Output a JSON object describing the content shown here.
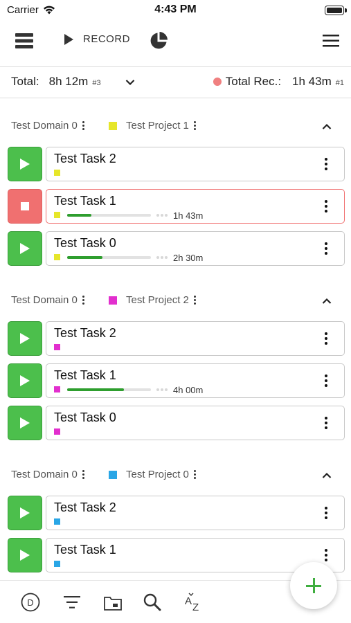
{
  "status_bar": {
    "carrier": "Carrier",
    "time": "4:43 PM"
  },
  "toolbar": {
    "record_label": "RECORD",
    "icons": [
      "list-view-icon",
      "play-icon",
      "pie-chart-icon",
      "hamburger-menu-icon"
    ]
  },
  "totals": {
    "total_label": "Total:",
    "total_value": "8h 12m",
    "total_count": "#3",
    "rec_label": "Total Rec.:",
    "rec_value": "1h 43m",
    "rec_count": "#1"
  },
  "colors": {
    "play_green": "#4cbf4c",
    "stop_red": "#f07070",
    "project_1": "#e6e62a",
    "project_2": "#e22fce",
    "project_0": "#29a6e6",
    "progress": "#2e9e2e"
  },
  "groups": [
    {
      "domain": "Test Domain 0",
      "project": "Test Project 1",
      "tasks": [
        {
          "name": "Test Task 2",
          "state": "idle"
        },
        {
          "name": "Test Task 1",
          "state": "recording",
          "duration": "1h 43m",
          "progress": 0.29
        },
        {
          "name": "Test Task 0",
          "state": "idle",
          "duration": "2h 30m",
          "progress": 0.42
        }
      ]
    },
    {
      "domain": "Test Domain 0",
      "project": "Test Project 2",
      "tasks": [
        {
          "name": "Test Task 2",
          "state": "idle"
        },
        {
          "name": "Test Task 1",
          "state": "idle",
          "duration": "4h 00m",
          "progress": 0.68
        },
        {
          "name": "Test Task 0",
          "state": "idle"
        }
      ]
    },
    {
      "domain": "Test Domain 0",
      "project": "Test Project 0",
      "tasks": [
        {
          "name": "Test Task 2",
          "state": "idle"
        },
        {
          "name": "Test Task 1",
          "state": "idle"
        }
      ]
    }
  ],
  "bottom_bar": {
    "domain_badge": "D",
    "icons": [
      "domain-filter-icon",
      "filter-icon",
      "folder-icon",
      "search-icon",
      "sort-az-icon"
    ]
  },
  "fab": {
    "icon": "add-icon"
  }
}
